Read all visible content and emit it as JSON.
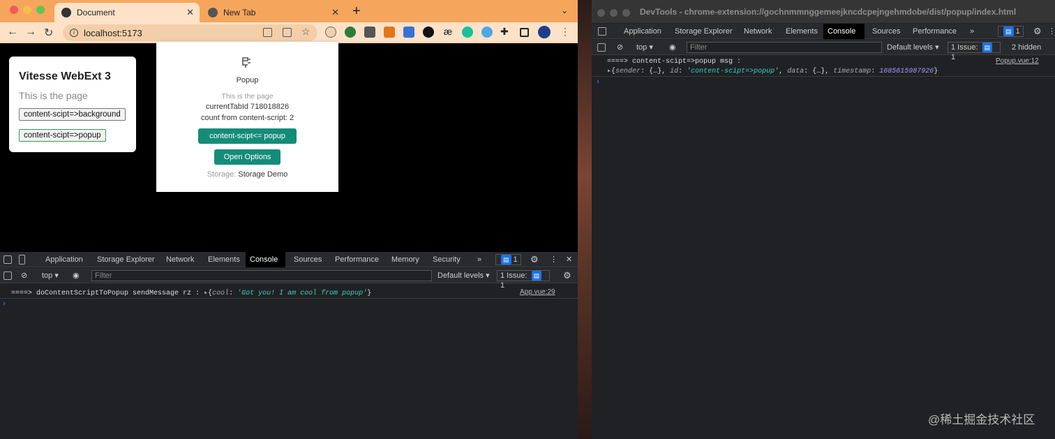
{
  "browser": {
    "tabs": [
      {
        "label": "Document"
      },
      {
        "label": "New Tab"
      }
    ],
    "url": "localhost:5173"
  },
  "page": {
    "title": "Vitesse WebExt 3",
    "subtitle": "This is the page",
    "btn_background": "content-scipt=>background",
    "btn_popup": "content-scipt=>popup"
  },
  "popup": {
    "title": "Popup",
    "line1": "This is the page",
    "line2": "currentTabId 718018826",
    "line3": "count from content-script: 2",
    "btn_send": "content-scipt<= popup",
    "btn_options": "Open Options",
    "storage_label": "Storage:",
    "storage_value": "Storage Demo"
  },
  "devtools_bottom": {
    "tabs": [
      "Application",
      "Storage Explorer",
      "Network",
      "Elements",
      "Console",
      "Sources",
      "Performance",
      "Memory",
      "Security"
    ],
    "active_tab": "Console",
    "context": "top",
    "filter_placeholder": "Filter",
    "levels": "Default levels",
    "issues": "1 Issue:",
    "issues_count": "1",
    "msg_count": "1",
    "log_prefix": "====> doContentScriptToPopup sendMessage rz :",
    "log_key": "cool",
    "log_value": "'Got you! I am cool from popup'",
    "log_source": "App.vue:29"
  },
  "devtools_right": {
    "window_title": "DevTools - chrome-extension://gochnmmnggemeejkncdcpejngehmdobe/dist/popup/index.html",
    "tabs": [
      "Application",
      "Storage Explorer",
      "Network",
      "Elements",
      "Console",
      "Sources",
      "Performance"
    ],
    "active_tab": "Console",
    "context": "top",
    "filter_placeholder": "Filter",
    "levels": "Default levels",
    "issues": "1 Issue:",
    "issues_count": "1",
    "hidden": "2 hidden",
    "msg_count": "1",
    "log_line1": "====> content-scipt=>popup msg :",
    "log_source": "Popup.vue:12",
    "log_obj_sender": "sender",
    "log_obj_id": "id",
    "log_obj_id_val": "'content-scipt=>popup'",
    "log_obj_data": "data",
    "log_obj_ts": "timestamp",
    "log_obj_ts_val": "1685615987926",
    "ellipsis": "{…}"
  },
  "watermark": "@稀土掘金技术社区"
}
